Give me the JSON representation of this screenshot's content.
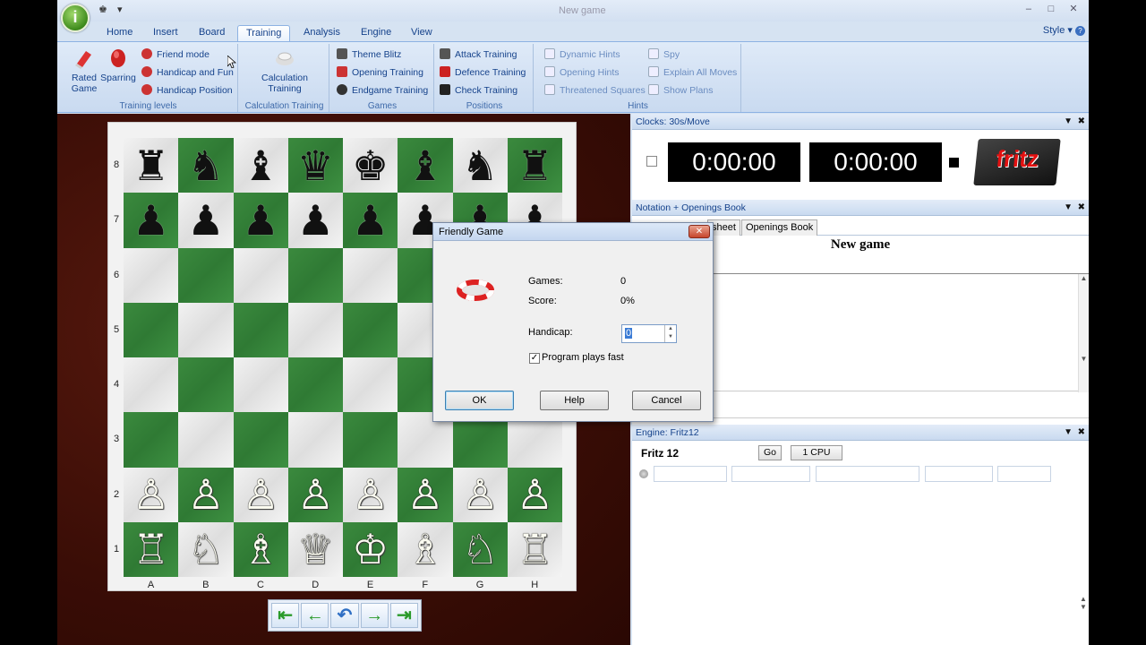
{
  "window": {
    "title": "New game"
  },
  "qat": {
    "icon1": "♚",
    "dropdown": "▾"
  },
  "win_controls": {
    "minimize": "–",
    "maximize": "□",
    "close": "✕"
  },
  "orb": {
    "label": "i"
  },
  "tabs": [
    "Home",
    "Insert",
    "Board",
    "Training",
    "Analysis",
    "Engine",
    "View"
  ],
  "active_tab": "Training",
  "style_menu": "Style",
  "ribbon": {
    "training_levels": {
      "label": "Training levels",
      "rated_game": [
        "Rated",
        "Game"
      ],
      "sparring": "Sparring",
      "friend_mode": "Friend mode",
      "handicap_fun": "Handicap and Fun",
      "handicap_position": "Handicap Position"
    },
    "calculation": {
      "label": "Calculation Training",
      "button": [
        "Calculation",
        "Training"
      ]
    },
    "games": {
      "label": "Games",
      "theme_blitz": "Theme Blitz",
      "opening_training": "Opening Training",
      "endgame_training": "Endgame Training"
    },
    "positions": {
      "label": "Positions",
      "attack_training": "Attack Training",
      "defence_training": "Defence Training",
      "check_training": "Check Training"
    },
    "hints": {
      "label": "Hints",
      "dynamic_hints": "Dynamic Hints",
      "opening_hints": "Opening Hints",
      "threatened_squares": "Threatened Squares",
      "spy": "Spy",
      "explain_all_moves": "Explain All Moves",
      "show_plans": "Show Plans"
    }
  },
  "board": {
    "ranks": [
      "8",
      "7",
      "6",
      "5",
      "4",
      "3",
      "2",
      "1"
    ],
    "files": [
      "A",
      "B",
      "C",
      "D",
      "E",
      "F",
      "G",
      "H"
    ],
    "position": [
      "rnbqkbnr",
      "pppppppp",
      "........",
      "........",
      "........",
      "........",
      "PPPPPPPP",
      "RNBQKBNR"
    ]
  },
  "nav_buttons": [
    "⇤",
    "←",
    "↶",
    "→",
    "⇥"
  ],
  "clocks": {
    "header": "Clocks: 30s/Move",
    "white": "0:00:00",
    "black": "0:00:00",
    "logo": "fritz"
  },
  "notation": {
    "header": "Notation + Openings Book",
    "tab1": "sheet",
    "tab2": "Openings Book",
    "title": "New game"
  },
  "engine": {
    "header": "Engine: Fritz12",
    "name": "Fritz 12",
    "go": "Go",
    "cpu": "1 CPU"
  },
  "pane_controls": {
    "dropdown": "▼",
    "close": "✖"
  },
  "scroll_arrows": {
    "up": "▲",
    "down": "▼"
  },
  "dialog": {
    "title": "Friendly Game",
    "games_label": "Games:",
    "games_value": "0",
    "score_label": "Score:",
    "score_value": "0%",
    "handicap_label": "Handicap:",
    "handicap_value": "0",
    "fast_label": "Program plays fast",
    "fast_checked": true,
    "ok": "OK",
    "help": "Help",
    "cancel": "Cancel",
    "close": "✕"
  }
}
